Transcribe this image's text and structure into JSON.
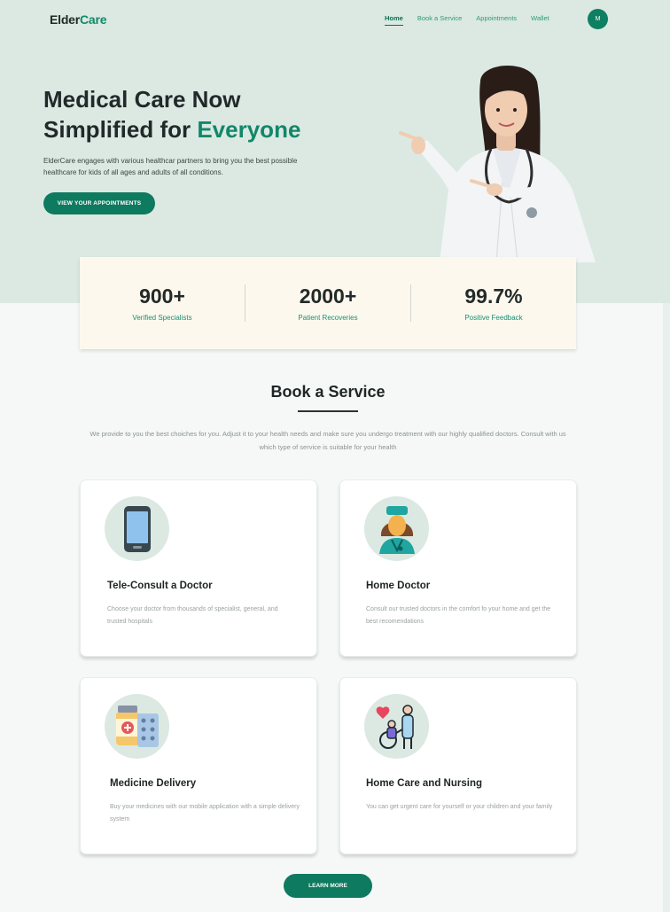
{
  "brand": {
    "name_part1": "Elder",
    "name_part2": "Care",
    "accent_color": "#0e8a6a"
  },
  "nav": {
    "items": [
      {
        "label": "Home",
        "active": true
      },
      {
        "label": "Book a Service",
        "active": false
      },
      {
        "label": "Appointments",
        "active": false
      },
      {
        "label": "Wallet",
        "active": false
      }
    ],
    "avatar_initial": "M"
  },
  "hero": {
    "title_line1": "Medical Care Now",
    "title_line2_prefix": "Simplified for ",
    "title_line2_accent": "Everyone",
    "description": "ElderCare engages with various healthcar partners to bring you the best possible healthcare for kids of all ages and adults of all conditions.",
    "button_label": "VIEW YOUR APPOINTMENTS"
  },
  "stats": [
    {
      "value": "900+",
      "label": "Verified Specialists"
    },
    {
      "value": "2000+",
      "label": "Patient Recoveries"
    },
    {
      "value": "99.7%",
      "label": "Positive Feedback"
    }
  ],
  "services": {
    "title": "Book a Service",
    "description": "We provide to you the best choiches for you. Adjust it to your health needs and make sure you undergo treatment with our highly qualified doctors. Consult with us which type of service is suitable for your health",
    "cards": [
      {
        "title": "Tele-Consult a Doctor",
        "description": "Choose your doctor from thousands of specialist, general, and trusted hospitals",
        "icon": "smartphone-icon"
      },
      {
        "title": "Home Doctor",
        "description": "Consult our trusted doctors in the comfort fo your home and get the best recomendations",
        "icon": "doctor-icon"
      },
      {
        "title": "Medicine Delivery",
        "description": "Buy your medicines with our mobile application with a simple delivery system",
        "icon": "medicine-icon"
      },
      {
        "title": "Home Care and Nursing",
        "description": "You can get urgent care for yourself or your children and your family",
        "icon": "nursing-icon"
      }
    ],
    "learn_more_label": "LEARN MORE"
  }
}
